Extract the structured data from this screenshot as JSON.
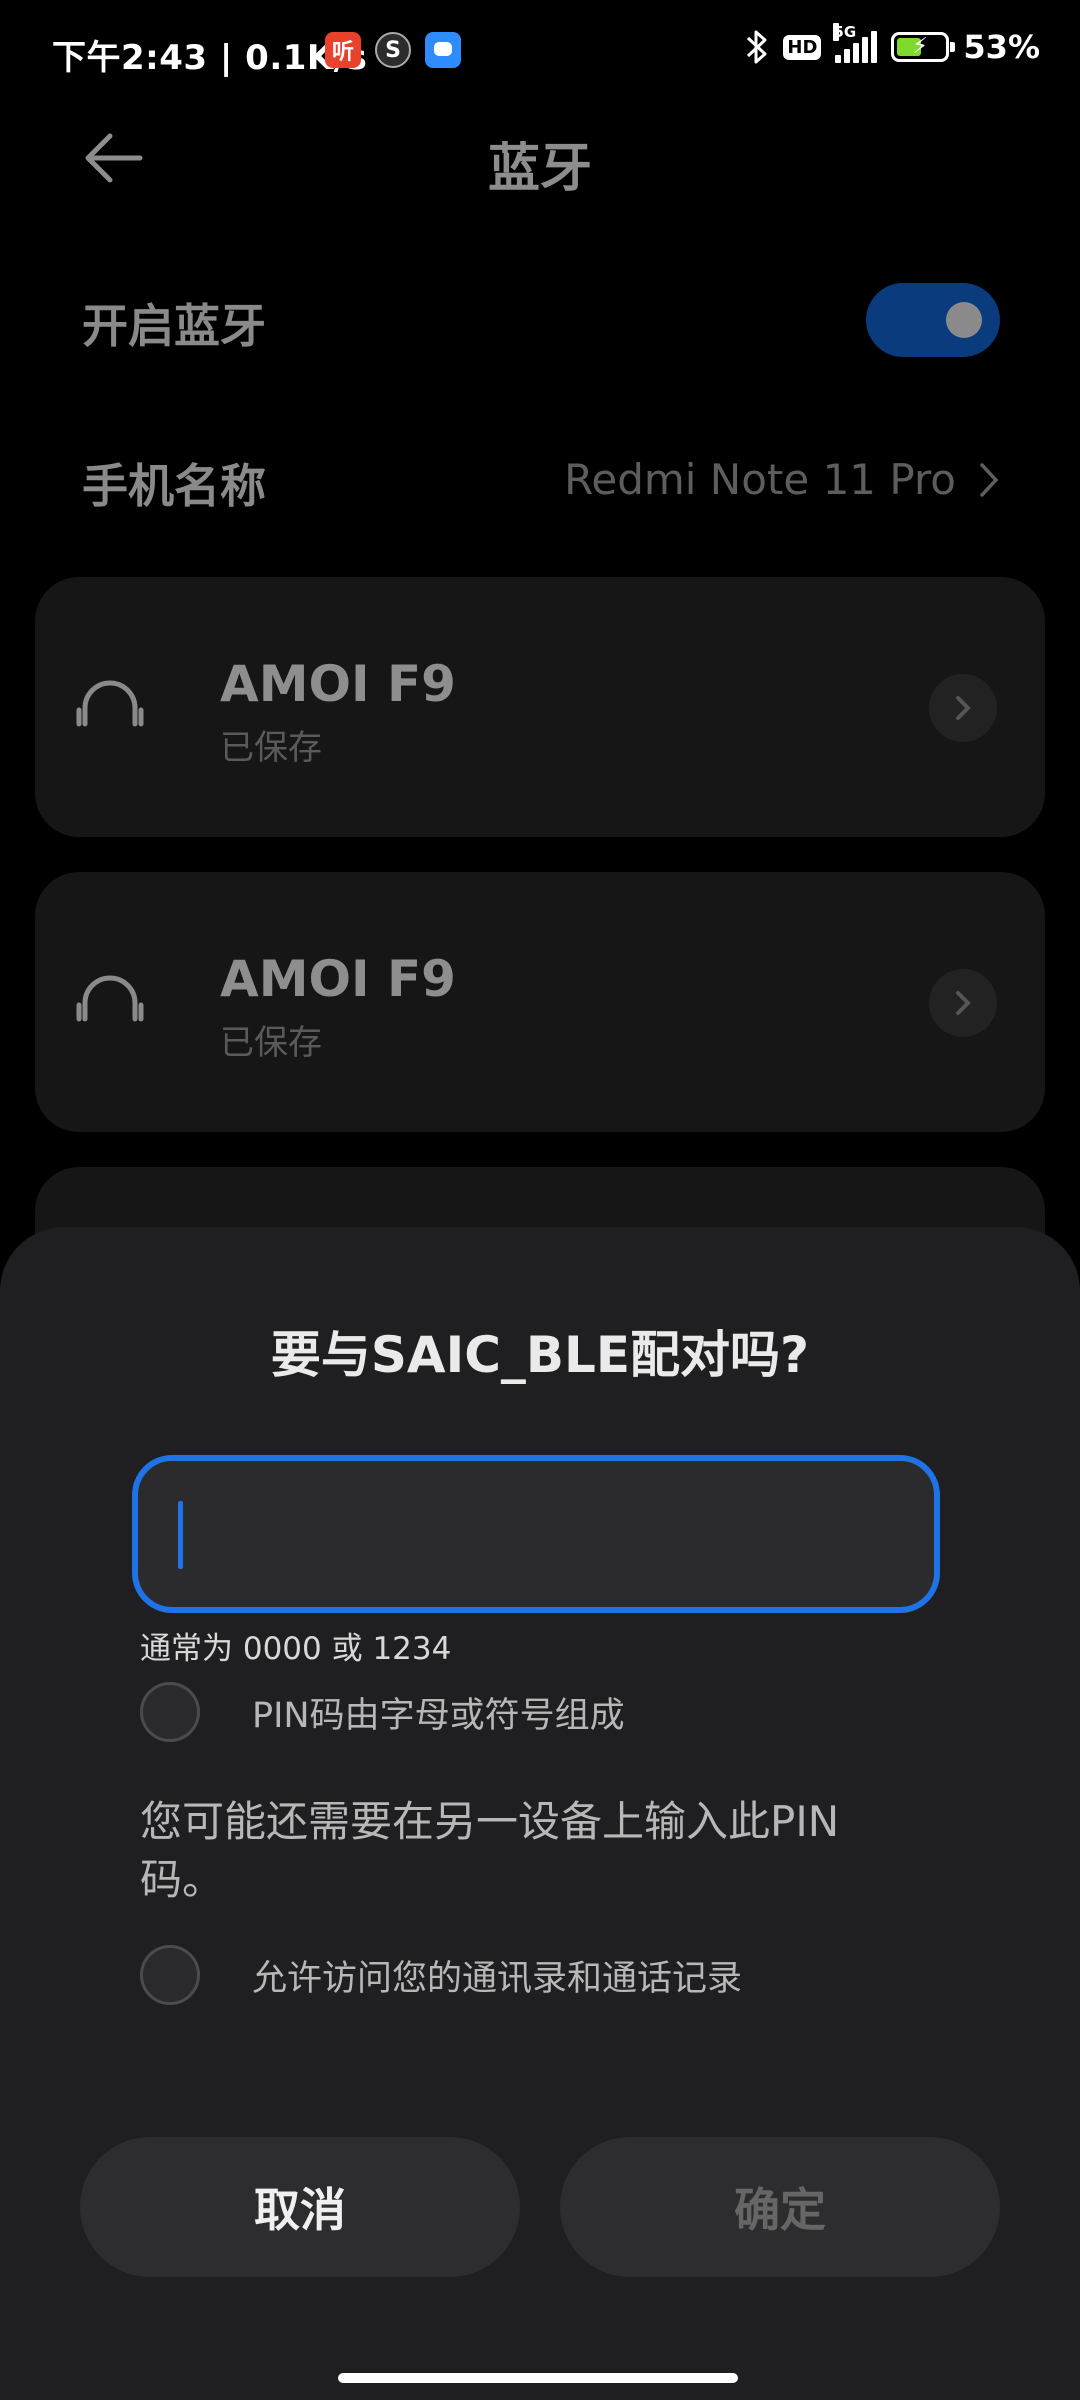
{
  "status_bar": {
    "time_speed": "下午2:43 | 0.1K/s",
    "app_badges": [
      {
        "icon": "ting-app-icon",
        "glyph": "听",
        "color": "#e8412c"
      },
      {
        "icon": "s-app-icon",
        "glyph": "S",
        "color": "#3a3a3a"
      },
      {
        "icon": "message-app-icon",
        "glyph": "",
        "color": "#2f8cff"
      }
    ],
    "hd": "HD",
    "network": "5G",
    "battery": "53%",
    "battery_level": 0.53
  },
  "header": {
    "title": "蓝牙",
    "back_icon": "arrow-left-icon"
  },
  "bluetooth_toggle": {
    "label": "开启蓝牙",
    "state": true,
    "accent": "#0a3b7c"
  },
  "phone_name": {
    "label": "手机名称",
    "value": "Redmi Note 11 Pro"
  },
  "devices": [
    {
      "name": "AMOI F9",
      "status": "已保存",
      "icon": "headphones-icon"
    },
    {
      "name": "AMOI F9",
      "status": "已保存",
      "icon": "headphones-icon"
    }
  ],
  "dialog": {
    "title": "要与SAIC_BLE配对吗?",
    "pin_value": "",
    "hint": "通常为 0000 或 1234",
    "option_alnum": "PIN码由字母或符号组成",
    "note": "您可能还需要在另一设备上输入此PIN码。",
    "option_contacts": "允许访问您的通讯录和通话记录",
    "cancel_label": "取消",
    "ok_label": "确定",
    "accent": "#1f73e6"
  }
}
